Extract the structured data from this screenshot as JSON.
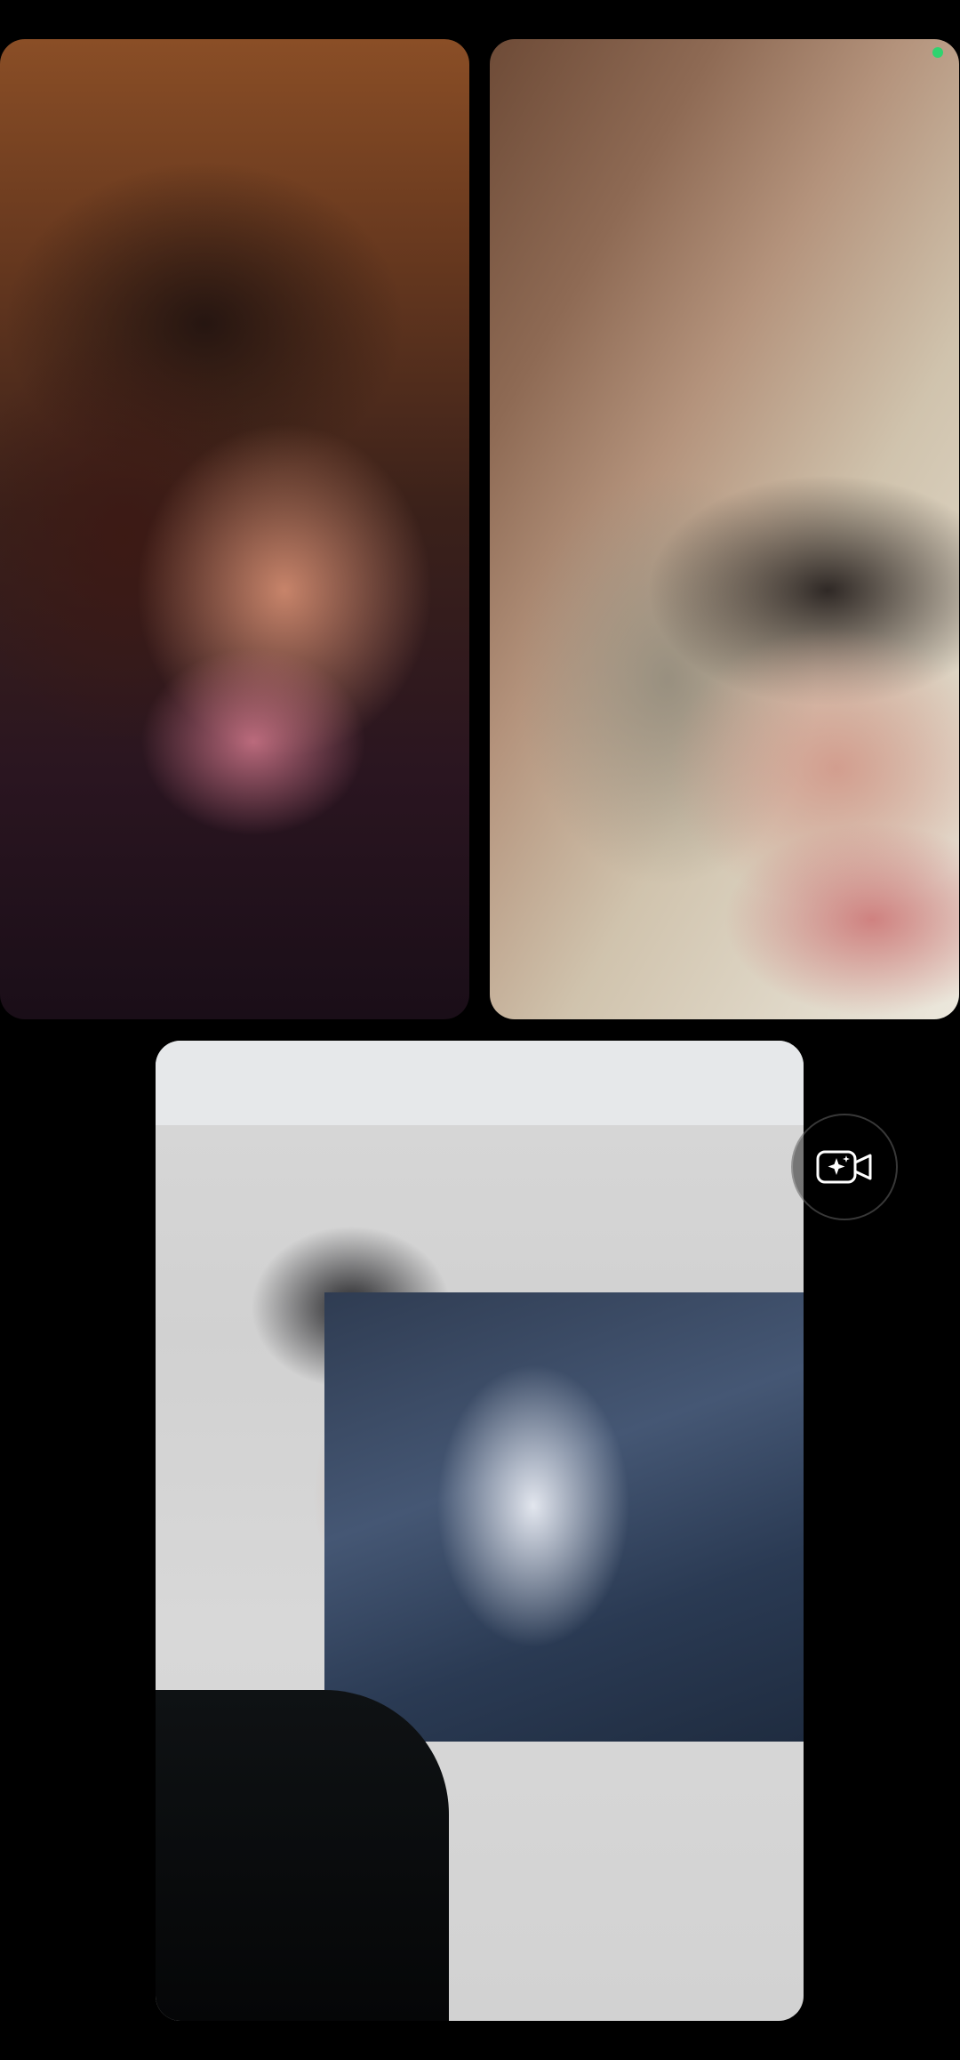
{
  "call": {
    "participants": [
      {
        "tile": "top-left"
      },
      {
        "tile": "top-right"
      },
      {
        "tile": "bottom-center"
      }
    ],
    "controls": {
      "effects_icon": "camera-sparkle-icon"
    },
    "indicators": {
      "active_status_color": "#2fd36f"
    }
  },
  "colors": {
    "background": "#000000",
    "accent_green": "#2fd36f"
  }
}
